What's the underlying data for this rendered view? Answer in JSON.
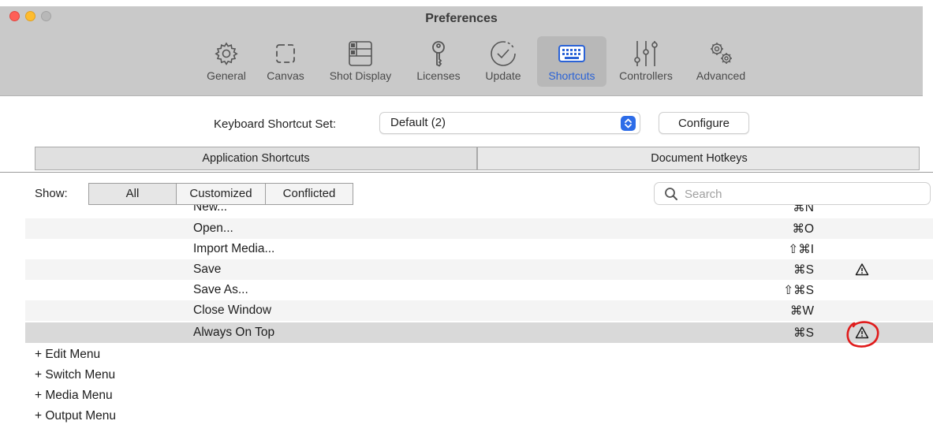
{
  "window": {
    "title": "Preferences"
  },
  "toolbar": {
    "tabs": [
      {
        "label": "General",
        "icon": "gear-icon"
      },
      {
        "label": "Canvas",
        "icon": "dashed-frame-icon"
      },
      {
        "label": "Shot Display",
        "icon": "grid-layout-icon"
      },
      {
        "label": "Licenses",
        "icon": "key-icon"
      },
      {
        "label": "Update",
        "icon": "refresh-check-icon"
      },
      {
        "label": "Shortcuts",
        "icon": "keyboard-icon",
        "active": true
      },
      {
        "label": "Controllers",
        "icon": "sliders-icon"
      },
      {
        "label": "Advanced",
        "icon": "gears-icon"
      }
    ]
  },
  "shortcut_set": {
    "label": "Keyboard Shortcut Set:",
    "selected": "Default (2)",
    "configure_label": "Configure"
  },
  "segments": {
    "application": "Application Shortcuts",
    "document": "Document Hotkeys"
  },
  "filter": {
    "show_label": "Show:",
    "all": "All",
    "customized": "Customized",
    "conflicted": "Conflicted",
    "search_placeholder": "Search"
  },
  "rows": [
    {
      "name": "New...",
      "key": "⌘N"
    },
    {
      "name": "Open...",
      "key": "⌘O"
    },
    {
      "name": "Import Media...",
      "key": "⇧⌘I"
    },
    {
      "name": "Save",
      "key": "⌘S",
      "conflict": true
    },
    {
      "name": "Save As...",
      "key": "⇧⌘S"
    },
    {
      "name": "Close Window",
      "key": "⌘W"
    },
    {
      "name": "Always On Top",
      "key": "⌘S",
      "conflict": true,
      "selected": true
    }
  ],
  "groups": [
    {
      "label": "+ Edit Menu"
    },
    {
      "label": "+ Switch Menu"
    },
    {
      "label": "+ Media Menu"
    },
    {
      "label": "+ Output Menu"
    }
  ],
  "colors": {
    "accent": "#2a62d6",
    "annotation": "#e01b1b",
    "toolbar_bg": "#c9c9c9",
    "selected_row": "#d9d9d9"
  }
}
